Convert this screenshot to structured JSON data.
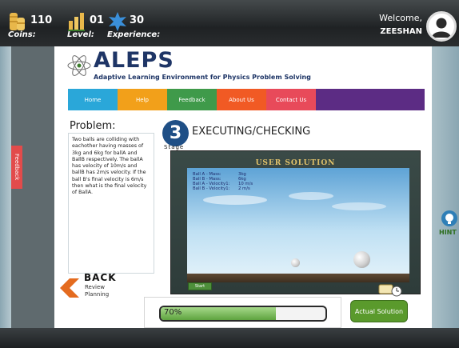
{
  "header": {
    "coins": {
      "value": "110",
      "label": "Coins:",
      "icon": "coin-stack-icon"
    },
    "level": {
      "value": "01",
      "label": "Level:",
      "icon": "level-bars-icon"
    },
    "experience": {
      "value": "30",
      "label": "Experience:",
      "icon": "star-burst-icon"
    },
    "welcome": "Welcome,",
    "username": "ZEESHAN",
    "avatar_icon": "user-avatar-icon"
  },
  "brand": {
    "name": "ALEPS",
    "tagline": "Adaptive Learning Environment for Physics Problem Solving"
  },
  "nav": [
    {
      "label": "Home",
      "color": "#2aa7d9"
    },
    {
      "label": "Help",
      "color": "#f2a01a"
    },
    {
      "label": "Feedback",
      "color": "#3f9a4a"
    },
    {
      "label": "About Us",
      "color": "#f15a24"
    },
    {
      "label": "Contact Us",
      "color": "#e84a5a"
    },
    {
      "label": "",
      "color": "#5c2c84"
    }
  ],
  "problem": {
    "title": "Problem:",
    "text": "Two balls are colliding with eachother having masses of 3kg and 6kg for ballA and BallB respectively. The ballA has velocity of 10m/s and ballB has 2m/s velocity. If the ball B's final velocity is 6m/s then what is the final velocity of BallA."
  },
  "step": {
    "number": "3",
    "title": "EXECUTING/CHECKING",
    "stage_label": "Stage"
  },
  "simulation": {
    "title": "USER SOLUTION",
    "readouts": [
      {
        "key": "Ball A - Mass:",
        "value": "3kg"
      },
      {
        "key": "Ball B - Mass:",
        "value": "6kg"
      },
      {
        "key": "Ball A - Velocity1:",
        "value": "10 m/s"
      },
      {
        "key": "Ball B - Velocity1:",
        "value": "2 m/s"
      }
    ],
    "start_label": "Start"
  },
  "back": {
    "title": "BACK",
    "sub1": "Review",
    "sub2": "Planning"
  },
  "progress": {
    "text": "70%",
    "fraction": 0.7
  },
  "actual_solution_label": "Actual Solution",
  "feedback_tab": "Feedback",
  "hint": {
    "label": "HINT",
    "icon": "lightbulb-icon"
  },
  "colors": {
    "brand_navy": "#1e3566",
    "accent_green": "#5a9a2c",
    "feedback_red": "#e24b4b"
  }
}
